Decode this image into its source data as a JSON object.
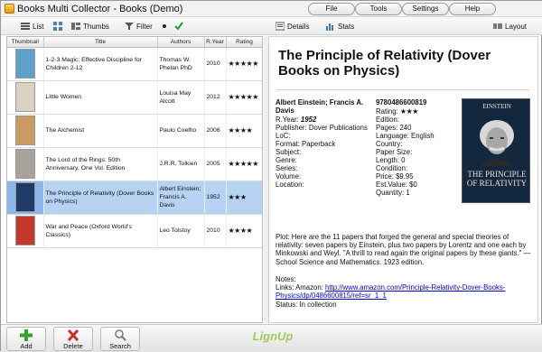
{
  "app": {
    "title": "Books Multi Collector - Books (Demo)",
    "menus": [
      "File",
      "Tools",
      "Settings",
      "Help"
    ]
  },
  "toolbar": {
    "list": "List",
    "thumbs": "Thumbs",
    "filter": "Filter",
    "details": "Details",
    "stats": "Stats",
    "layout": "Layout"
  },
  "table": {
    "columns": [
      "Thumbnail",
      "Title",
      "Authors",
      "R.Year",
      "Rating"
    ],
    "rows": [
      {
        "title": "1-2-3 Magic: Effective Discipline for Children 2-12",
        "authors": "Thomas W. Phelan PhD",
        "year": "2010",
        "rating": "★★★★★",
        "cover": "#5fa0c8"
      },
      {
        "title": "Little Women",
        "authors": "Louisa May Alcott",
        "year": "2012",
        "rating": "★★★★★",
        "cover": "#d9d2c0"
      },
      {
        "title": "The Alchemist",
        "authors": "Paulo Coelho",
        "year": "2006",
        "rating": "★★★★",
        "cover": "#c79b63"
      },
      {
        "title": "The Lord of the Rings: 50th Anniversary, One Vol. Edition",
        "authors": "J.R.R. Tolkien",
        "year": "2005",
        "rating": "★★★★★",
        "cover": "#a8a39a"
      },
      {
        "title": "The Principle of Relativity (Dover Books on Physics)",
        "authors": "Albert Einstein; Francis A. Davis",
        "year": "1952",
        "rating": "★★★",
        "cover": "#1e3a66"
      },
      {
        "title": "War and Peace (Oxford World's Classics)",
        "authors": "Leo Tolstoy",
        "year": "2010",
        "rating": "★★★★",
        "cover": "#c2392b"
      }
    ]
  },
  "detail": {
    "title": "The Principle of Relativity (Dover Books on Physics)",
    "authors": "Albert Einstein; Francis A. Davis",
    "isbn": "9780486600819",
    "rating_label": "Rating:",
    "rating": "★★★",
    "ryear_label": "R.Year:",
    "ryear": "1952",
    "publisher": "Publisher: Dover Publications",
    "loc": "LoC:",
    "format": "Format: Paperback",
    "subject": "Subject:",
    "genre": "Genre:",
    "series": "Series:",
    "volume": "Volume:",
    "location": "Location:",
    "edition": "Edition:",
    "pages": "Pages: 240",
    "language": "Language: English",
    "country": "Country:",
    "papersize": "Paper Size:",
    "length": "Length: 0",
    "condition": "Condition:",
    "price": "Price: $9.95",
    "estvalue": "Est.Value: $0",
    "quantity": "Quantity: 1",
    "cover_author": "EINSTEIN",
    "cover_title": "THE PRINCIPLE OF RELATIVITY",
    "plot": "Plot: Here are the 11 papers that forged the general and special theories of relativity: seven papers by Einstein, plus two papers by Lorentz and one each by Minkowski and Weyl. \"A thrill to read again the original papers by these giants.\" — School Science and Mathematics. 1923 edition.",
    "notes_label": "Notes:",
    "links_label": "Links: Amazon:",
    "link": "http://www.amazon.com/Principle-Relativity-Dover-Books-Physics/dp/0486600815/ref=sr_1_1",
    "status": "Status: In collection"
  },
  "bottom": {
    "add": "Add",
    "delete": "Delete",
    "search": "Search",
    "logo": "LignUp"
  },
  "colors": {
    "selected_row": "#b7d3f4",
    "add_icon": "#2fa52f",
    "delete_icon": "#d42a2a"
  }
}
